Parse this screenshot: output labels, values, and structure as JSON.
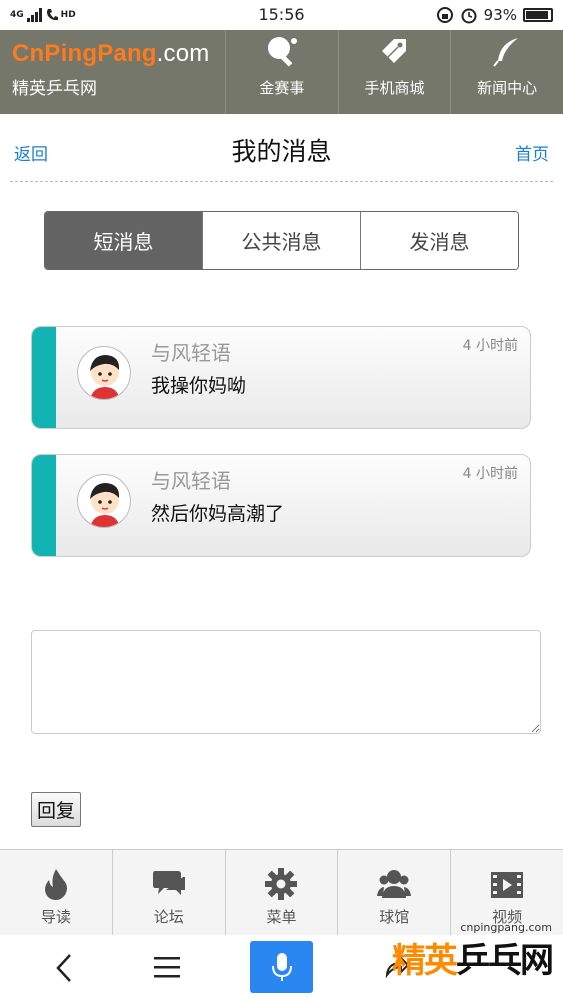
{
  "status_bar": {
    "network": "4G",
    "hd": "HD",
    "time": "15:56",
    "battery": "93%"
  },
  "header": {
    "logo_brand": "CnPingPang",
    "logo_suffix": ".com",
    "logo_subtitle": "精英乒乓网",
    "nav": [
      {
        "label": "金赛事",
        "icon": "paddle-icon"
      },
      {
        "label": "手机商城",
        "icon": "tag-icon"
      },
      {
        "label": "新闻中心",
        "icon": "feather-icon"
      }
    ]
  },
  "titlebar": {
    "back": "返回",
    "title": "我的消息",
    "home": "首页"
  },
  "tabs": [
    {
      "label": "短消息",
      "active": true
    },
    {
      "label": "公共消息",
      "active": false
    },
    {
      "label": "发消息",
      "active": false
    }
  ],
  "messages": [
    {
      "sender": "与风轻语",
      "time": "4 小时前",
      "text": "我操你妈呦"
    },
    {
      "sender": "与风轻语",
      "time": "4 小时前",
      "text": "然后你妈高潮了"
    }
  ],
  "reply": {
    "button": "回复"
  },
  "bottom_nav": [
    {
      "label": "导读",
      "icon": "flame-icon"
    },
    {
      "label": "论坛",
      "icon": "chat-icon"
    },
    {
      "label": "菜单",
      "icon": "gear-icon"
    },
    {
      "label": "球馆",
      "icon": "people-icon"
    },
    {
      "label": "视频",
      "icon": "film-icon"
    }
  ],
  "watermark": {
    "url": "cnpingpang.com",
    "text_a": "精英",
    "text_b": "乒乓网"
  },
  "colors": {
    "header_bg": "#75776b",
    "accent_teal": "#12b3b3",
    "link_blue": "#1a7fd4",
    "brand_orange": "#ff7a1a",
    "mic_blue": "#2a86f0"
  }
}
